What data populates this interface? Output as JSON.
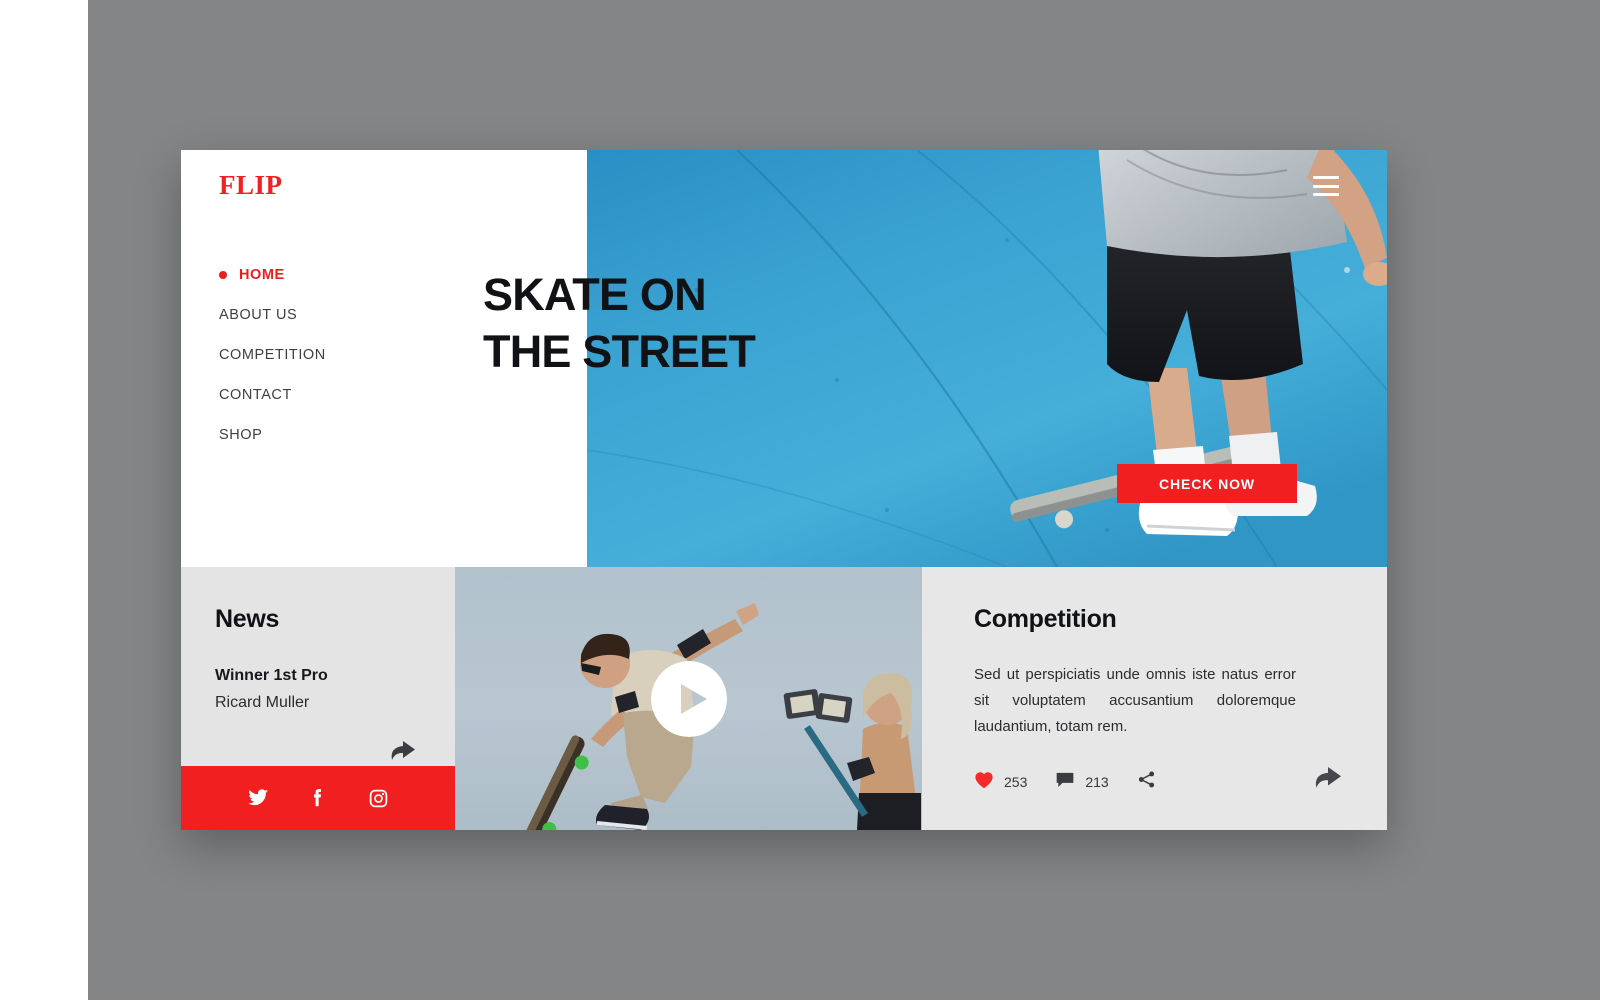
{
  "theme": {
    "backdrop": "#848587",
    "brand_red": "#f11f1f",
    "panel_gray": "#e5e5e5",
    "text_dark": "#111215"
  },
  "brand": {
    "logo": "FLIP"
  },
  "nav": {
    "items": [
      {
        "label": "HOME",
        "active": true
      },
      {
        "label": "ABOUT US",
        "active": false
      },
      {
        "label": "COMPETITION",
        "active": false
      },
      {
        "label": "CONTACT",
        "active": false
      },
      {
        "label": "SHOP",
        "active": false
      }
    ]
  },
  "hero": {
    "title_line1": "SKATE ON",
    "title_line2": "THE STREET",
    "cta_label": "CHECK NOW",
    "menu_icon": "hamburger-icon",
    "image_alt": "skateboarder riding on blue skate ramp"
  },
  "news": {
    "title": "News",
    "headline": "Winner 1st Pro",
    "author": "Ricard Muller",
    "share_icon": "share-arrow-icon",
    "social": [
      {
        "name": "twitter",
        "icon": "twitter-icon"
      },
      {
        "name": "facebook",
        "icon": "facebook-icon"
      },
      {
        "name": "instagram",
        "icon": "instagram-icon"
      }
    ]
  },
  "video": {
    "play_icon": "play-icon",
    "image_alt": "skateboarder doing a kickflip in mid air against pale sky"
  },
  "competition": {
    "title": "Competition",
    "body": "Sed ut perspiciatis unde omnis iste natus error sit voluptatem accusantium doloremque laudantium, totam rem.",
    "stats": [
      {
        "icon": "heart-icon",
        "value": "253"
      },
      {
        "icon": "comment-icon",
        "value": "213"
      }
    ],
    "share_small_icon": "share-node-icon",
    "share_icon": "share-arrow-icon"
  }
}
